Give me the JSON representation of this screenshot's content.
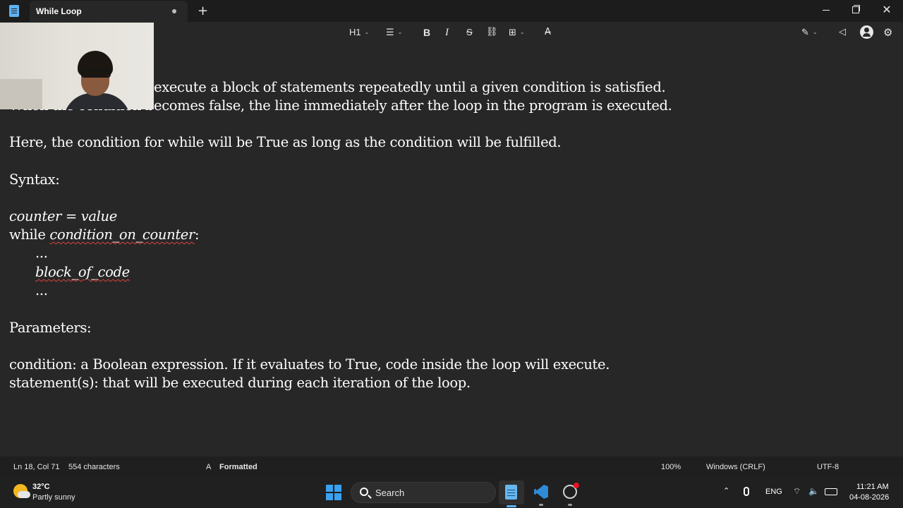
{
  "window": {
    "tab_title": "While Loop",
    "new_tab_glyph": "+",
    "close_glyph": "✕"
  },
  "toolbar": {
    "heading_label": "H1",
    "chevron": "⌄",
    "bold_label": "B",
    "italic_label": "I",
    "strike_label": "S",
    "list_icon": "☰",
    "link_icon": "⛓",
    "table_icon": "⊞",
    "clear_format_icon": "A̶",
    "copilot_icon": "✎",
    "share_icon": "◁",
    "settings_icon": "⚙"
  },
  "document": {
    "line1": "execute a block of statements repeatedly until a given condition is satisfied.",
    "line2": "When the condition becomes false, the line immediately after the loop in the program is executed.",
    "line3": "Here, the condition for while will be True as long as the condition will be fulfilled.",
    "syntax_heading": "Syntax:",
    "code_counter": "counter",
    "code_eq": " = ",
    "code_value": "value",
    "code_while": "while ",
    "code_condition": "condition_on_counter",
    "code_colon": ":",
    "code_ellipsis_1": "...",
    "code_block": "block_of_code",
    "code_ellipsis_2": "...",
    "parameters_heading": "Parameters:",
    "param_condition": "condition: a Boolean expression. If it evaluates to True, code inside the loop will execute.",
    "param_statement": "statement(s): that will be executed during each iteration of the loop."
  },
  "status_bar": {
    "position": "Ln 18, Col 71",
    "characters": "554 characters",
    "format_icon": "A",
    "format_state": "Formatted",
    "zoom": "100%",
    "line_ending": "Windows (CRLF)",
    "encoding": "UTF-8"
  },
  "taskbar": {
    "weather_temp": "32°C",
    "weather_desc": "Partly sunny",
    "search_label": "Search",
    "tray_chevron": "⌃",
    "language": "ENG",
    "wifi_icon": "⌔",
    "speaker_icon": "🔈",
    "time": "11:21 AM",
    "date": "04-08-2026"
  }
}
